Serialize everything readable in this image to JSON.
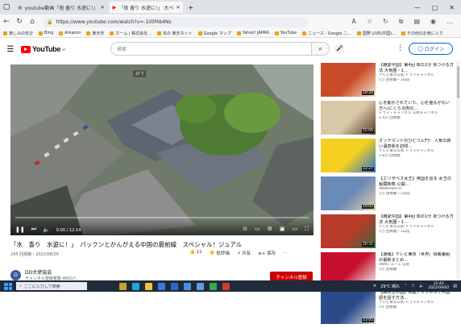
{
  "browser": {
    "tabs": [
      {
        "label": "youtube動画「夜 香り 水遊に!」"
      },
      {
        "label": "「夜 香り 水遊に!」 大ペ"
      }
    ],
    "url": "https://www.youtube.com/watch?v=-1ii0f4b4Ns",
    "bookmarks": [
      "楽しみの年計",
      "Bing",
      "Amazon",
      "楽天市",
      "ホーム | 株式会社...",
      "本の 楽天ネット",
      "Google マップ",
      "Yahoo! JAPAN",
      "YouTube",
      "ニュース - Google ニ...",
      "国際 LIVE(中国)...",
      "その他のお気に入り"
    ]
  },
  "youtube": {
    "logo": "YouTube",
    "logo_sup": "JP",
    "search_placeholder": "検索",
    "login": "ログイン"
  },
  "player": {
    "overlay_label": "ｽｸﾞﾜ",
    "time": "0:00 / 12:14",
    "progress": 0.0
  },
  "video": {
    "title": "「水　香り　水遊に！」　パックンとかんがえる中国の最前線　スペシャル！ジュアル",
    "meta": "245 回視聴・2022/08/20",
    "likes": "11",
    "dislike_label": "低評価",
    "share_label": "共有",
    "save_label": "保存",
    "more": "…"
  },
  "channel": {
    "avatar_letter": "D",
    "name": "DD大使協会",
    "subs": "チャンネル登録者数 4810人",
    "subscribe": "チャンネル登録"
  },
  "recommendations": [
    {
      "title": "【親愛中国】第4回 体の1分 見つける方法 大気圏・1...",
      "channel": "テレビ東京公式 ドラマチャンネル",
      "views": "1万 回視聴・1日前",
      "duration": "20:31",
      "colors": [
        "#c94b2a",
        "#f2e4c8"
      ]
    },
    {
      "title": "心を動かされていた、心を揺るがない方へ(にくらる肉の...",
      "channel": "ドラマ・チャンネル 公式チャンネル",
      "views": "2.4万 回視聴",
      "duration": "15:09",
      "colors": [
        "#d8c8a8",
        "#5a3a2a"
      ]
    },
    {
      "title": "オンデマンドのひとつ入門！ 人気の高い温泉街を訪問...",
      "channel": "テレビ東京公式 ドラマチャンネル",
      "views": "1.8万 回視聴",
      "duration": "12:27",
      "colors": [
        "#f5d020",
        "#2a74c8"
      ]
    },
    {
      "title": "【エリザベス女王】英国を巡る 女王の秘蔵映像 公開...",
      "channel": "ANNnewsCH",
      "views": "2万 回視聴・1日前",
      "duration": "10:02",
      "colors": [
        "#6a8ab8",
        "#e8d0a8"
      ]
    },
    {
      "title": "【親愛中国】第4回 体の1分 見つける方法 大気圏・1...",
      "channel": "テレビ東京公式 ドラマチャンネル",
      "views": "1万 回視聴・1日前",
      "duration": "20:31",
      "colors": [
        "#b83a2a",
        "#3a6a3a"
      ]
    },
    {
      "title": "【速報】テレビ東京「世界」情報番組の最新まとめ...",
      "channel": "ANNニュース 公式",
      "views": "3万 回視聴",
      "duration": "26:16",
      "colors": [
        "#c8102e",
        "#f0f0f0"
      ]
    },
    {
      "title": "【高校生中国】英語チャンネルで中国語を話す方法...",
      "channel": "テレビ東京公式 ドラマチャンネル",
      "views": "5千 回視聴",
      "duration": "13:05",
      "colors": [
        "#2a4a8a",
        "#d8d8d8"
      ]
    }
  ],
  "taskbar": {
    "search_placeholder": "ここに入力して検索",
    "weather": "29°C 晴れ",
    "time": "21:43",
    "date": "2022/09/02"
  },
  "colors": {
    "brand": "#ff0000",
    "link": "#065fd4",
    "subscribe": "#cc0000",
    "taskbar": "#1f2a3a"
  }
}
